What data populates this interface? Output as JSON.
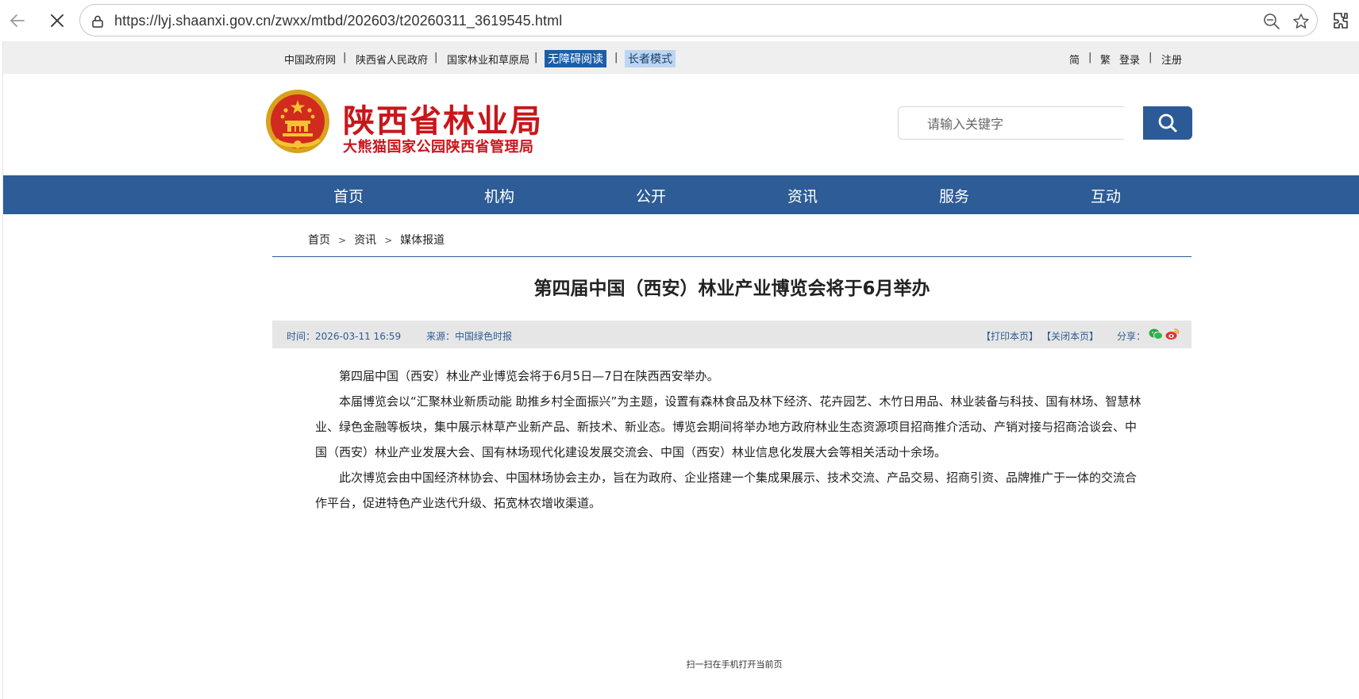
{
  "browser": {
    "url": "https://lyj.shaanxi.gov.cn/zwxx/mtbd/202603/t20260311_3619545.html"
  },
  "topbar": {
    "links": [
      "中国政府网",
      "陕西省人民政府",
      "国家林业和草原局"
    ],
    "accessible_reading": "无障碍阅读",
    "elder_mode": "长者模式",
    "simplified": "简",
    "traditional": "繁",
    "login": "登录",
    "register": "注册",
    "separator": "|"
  },
  "header": {
    "title": "陕西省林业局",
    "subtitle": "大熊猫国家公园陕西省管理局"
  },
  "search": {
    "placeholder": "请输入关键字"
  },
  "nav": {
    "items": [
      "首页",
      "机构",
      "公开",
      "资讯",
      "服务",
      "互动"
    ]
  },
  "breadcrumb": {
    "items": [
      "首页",
      "资讯",
      "媒体报道"
    ],
    "separator": ">"
  },
  "article": {
    "title": "第四届中国（西安）林业产业博览会将于6月举办",
    "time": "时间：2026-03-11 16:59",
    "source": "来源：中国绿色时报",
    "print": "【打印本页】",
    "close": "【关闭本页】",
    "share": "分享：",
    "paragraphs": [
      "第四届中国（西安）林业产业博览会将于6月5日—7日在陕西西安举办。",
      "本届博览会以“汇聚林业新质动能 助推乡村全面振兴”为主题，设置有森林食品及林下经济、花卉园艺、木竹日用品、林业装备与科技、国有林场、智慧林业、绿色金融等板块，集中展示林草产业新产品、新技术、新业态。博览会期间将举办地方政府林业生态资源项目招商推介活动、产销对接与招商洽谈会、中国（西安）林业产业发展大会、国有林场现代化建设发展交流会、中国（西安）林业信息化发展大会等相关活动十余场。",
      "此次博览会由中国经济林协会、中国林场协会主办，旨在为政府、企业搭建一个集成果展示、技术交流、产品交易、招商引资、品牌推广于一体的交流合作平台，促进特色产业迭代升级、拓宽林农增收渠道。"
    ]
  },
  "footer": {
    "qr_caption": "扫一扫在手机打开当前页"
  },
  "colors": {
    "nav_blue": "#2d5c96",
    "title_red": "#c9161b",
    "accessible_bg": "#1b5ea8",
    "elder_bg": "#bcd6f1"
  },
  "icons": [
    "back-arrow-icon",
    "stop-loading-icon",
    "site-info-icon",
    "zoom-icon",
    "favorite-star-icon",
    "extensions-icon",
    "search-icon",
    "wechat-icon",
    "weibo-icon",
    "national-emblem-icon"
  ]
}
